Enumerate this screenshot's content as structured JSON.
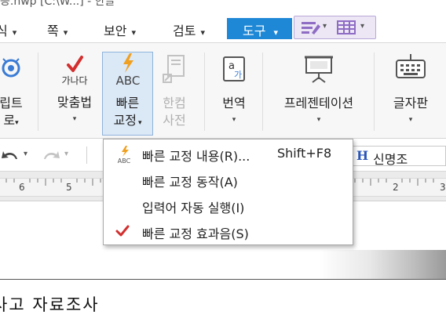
{
  "titlebar": {
    "text": "등.hwp [C:\\W...] - 한글"
  },
  "menubar": {
    "items": [
      {
        "label": "식"
      },
      {
        "label": "쪽"
      },
      {
        "label": "보안"
      },
      {
        "label": "검토"
      }
    ],
    "active_label": "도구",
    "active_color": "#1e88d6"
  },
  "ribbon": {
    "buttons": {
      "script": {
        "line1": "립트",
        "line2": "로"
      },
      "spellcheck": {
        "label": "맞춤법",
        "icon_text": "가나다"
      },
      "autocorrect": {
        "line1": "빠른",
        "line2": "교정",
        "icon_text": "ABC"
      },
      "hancom_dict": {
        "line1": "한컴",
        "line2": "사전"
      },
      "translate": {
        "label": "번역"
      },
      "presentation": {
        "label": "프레젠테이션"
      },
      "keyboard": {
        "label": "글자판"
      }
    }
  },
  "toolbar": {
    "font_name": "신명조",
    "font_icon": "H"
  },
  "ruler": {
    "numbers": [
      "6",
      "5",
      "2",
      "3"
    ]
  },
  "dropdown": {
    "items": [
      {
        "label": "빠른 교정 내용(R)...",
        "shortcut": "Shift+F8",
        "icon": "autocorrect-abc-icon"
      },
      {
        "label": "빠른 교정 동작(A)",
        "shortcut": "",
        "icon": ""
      },
      {
        "label": "입력어 자동 실행(I)",
        "shortcut": "",
        "icon": ""
      },
      {
        "label": "빠른 교정 효과음(S)",
        "shortcut": "",
        "icon": "checkmark-icon"
      }
    ]
  },
  "document": {
    "heading_text": "사고 자료조사"
  },
  "colors": {
    "check_red": "#d32f2f",
    "accent_blue": "#1e88d6",
    "bolt_orange": "#f0a020"
  }
}
